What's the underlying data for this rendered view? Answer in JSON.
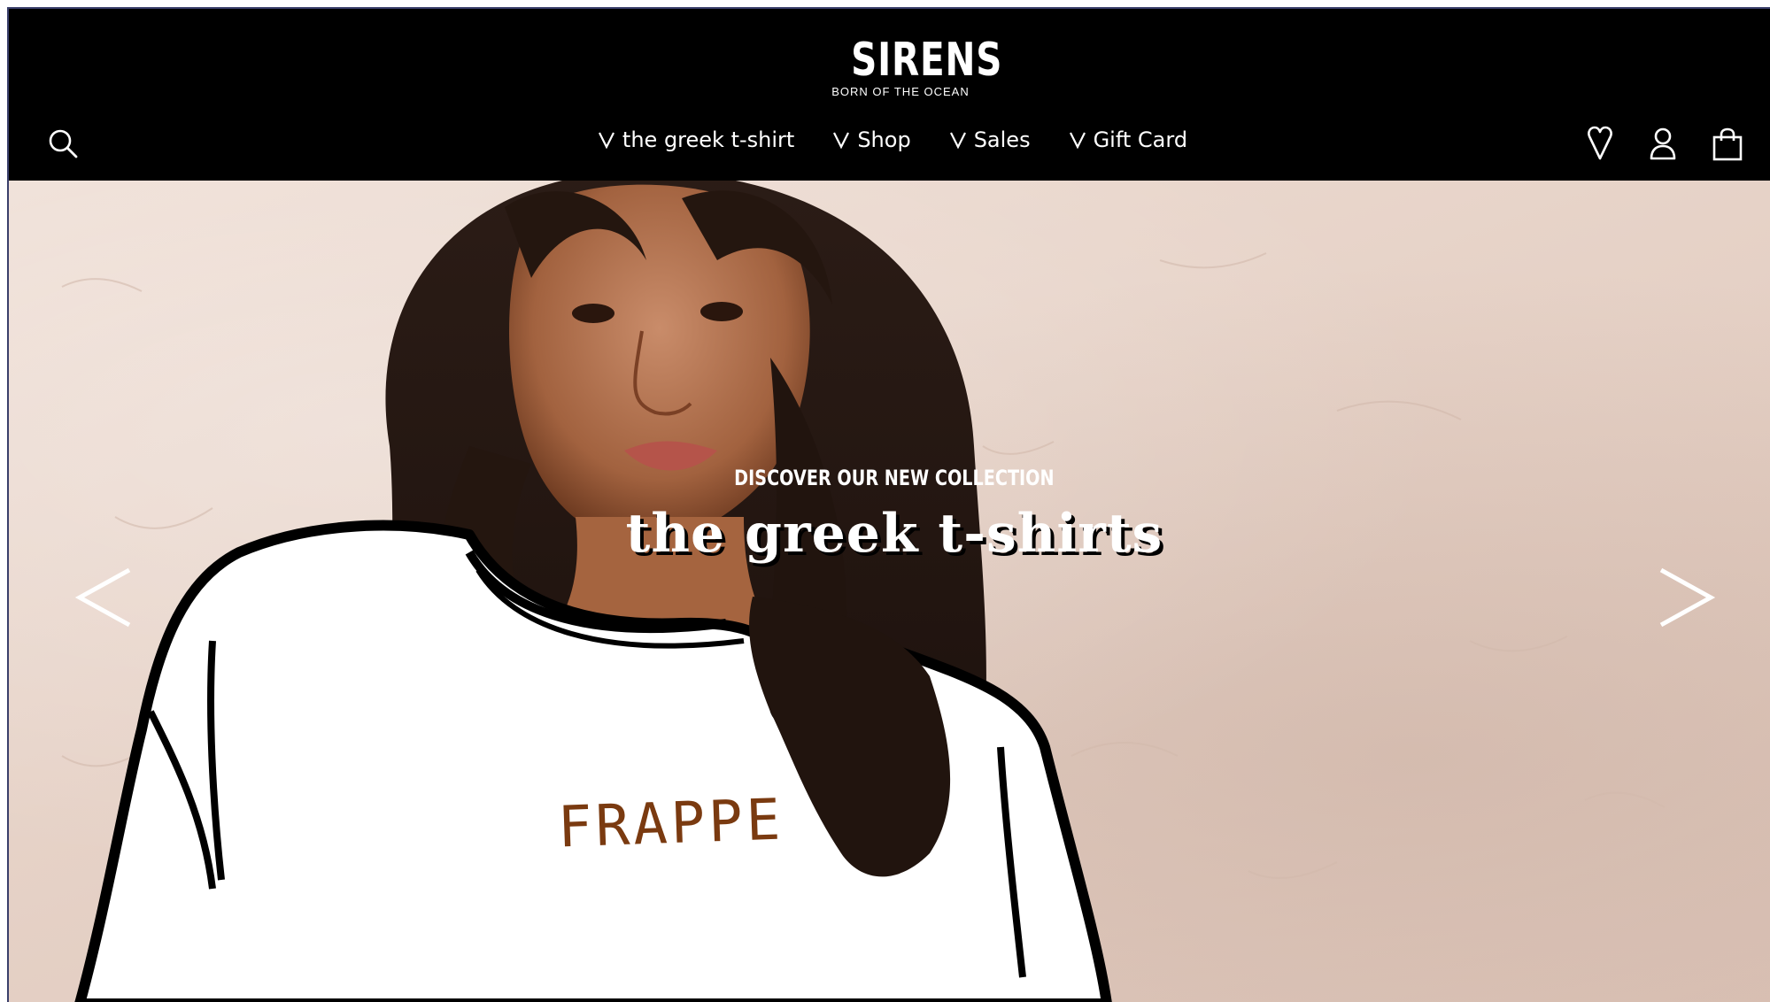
{
  "header": {
    "logo": {
      "word": "SIRENS",
      "tagline": "BORN OF THE OCEAN"
    },
    "nav": [
      {
        "label": "the greek t-shirt",
        "icon": "chevron-down-icon"
      },
      {
        "label": "Shop",
        "icon": "chevron-down-icon"
      },
      {
        "label": "Sales",
        "icon": "chevron-down-icon"
      },
      {
        "label": "Gift Card",
        "icon": "chevron-down-icon"
      }
    ],
    "icons": {
      "left": "search-icon",
      "right": [
        "wishlist-heart-icon",
        "account-icon",
        "shopping-bag-icon"
      ]
    }
  },
  "hero": {
    "eyebrow": "DISCOVER OUR NEW COLLECTION",
    "headline": "the greek t-shirts",
    "shirt_print": "FRAPPE",
    "prev_icon": "chevron-left-icon",
    "next_icon": "chevron-right-icon"
  },
  "colors": {
    "header_bg": "#000000",
    "header_text": "#ffffff",
    "hero_wall": "#e6d2c7",
    "shirt_print": "#7a3a10",
    "headline_shadow": "#000000"
  }
}
